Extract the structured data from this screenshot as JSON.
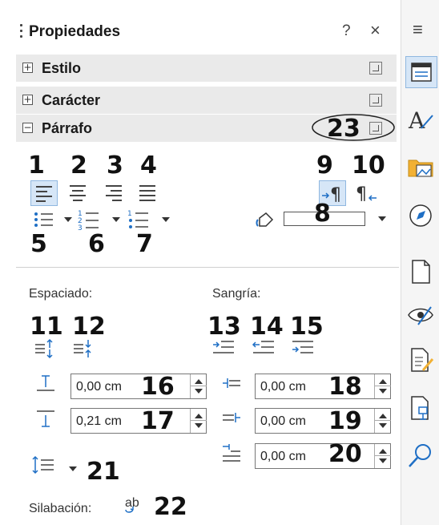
{
  "panel": {
    "title": "Propiedades",
    "help": "?",
    "close": "×",
    "menu": "≡"
  },
  "sections": [
    {
      "label": "Estilo",
      "expanded": false
    },
    {
      "label": "Carácter",
      "expanded": false
    },
    {
      "label": "Párrafo",
      "expanded": true
    }
  ],
  "callouts": {
    "n1": "1",
    "n2": "2",
    "n3": "3",
    "n4": "4",
    "n5": "5",
    "n6": "6",
    "n7": "7",
    "n8": "8",
    "n9": "9",
    "n10": "10",
    "n11": "11",
    "n12": "12",
    "n13": "13",
    "n14": "14",
    "n15": "15",
    "n16": "16",
    "n17": "17",
    "n18": "18",
    "n19": "19",
    "n20": "20",
    "n21": "21",
    "n22": "22",
    "n23": "23"
  },
  "paragraph": {
    "spacing_label": "Espaciado:",
    "indent_label": "Sangría:",
    "above_value": "0,00 cm",
    "below_value": "0,21 cm",
    "before_text_value": "0,00 cm",
    "after_text_value": "0,00 cm",
    "first_line_value": "0,00 cm",
    "hyphenation_label": "Silabación:",
    "hyphen_glyph": "ab"
  },
  "sidebar_tabs": [
    "properties-icon",
    "styles-icon",
    "gallery-icon",
    "navigator-icon",
    "page-icon",
    "style-inspector-icon",
    "manage-changes-icon",
    "design-icon",
    "find-icon"
  ],
  "colors": {
    "selected": "#d6e6f7",
    "accent": "#1f6fc5",
    "section_bg": "#eaeaea"
  }
}
